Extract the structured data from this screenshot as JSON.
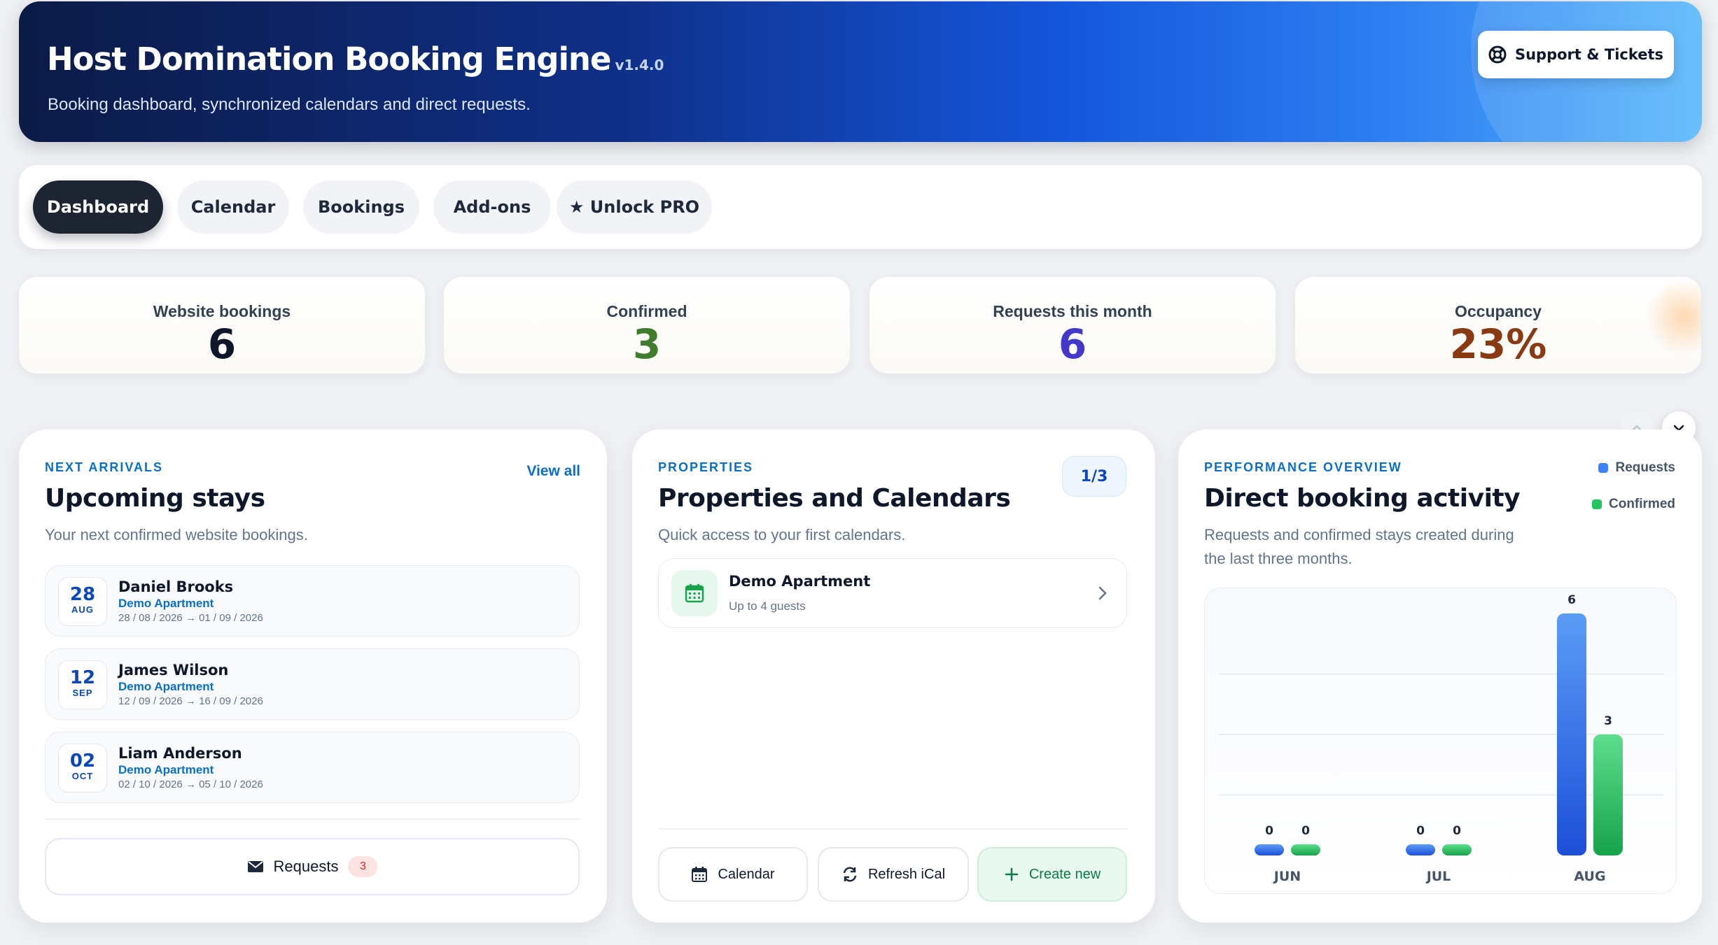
{
  "header": {
    "title": "Host Domination Booking Engine",
    "version": "v1.4.0",
    "subtitle": "Booking dashboard, synchronized calendars and direct requests.",
    "support_label": "Support & Tickets"
  },
  "nav": {
    "tabs": [
      {
        "label": "Dashboard",
        "active": true
      },
      {
        "label": "Calendar",
        "active": false
      },
      {
        "label": "Bookings",
        "active": false
      },
      {
        "label": "Add-ons",
        "active": false
      },
      {
        "label": "★ Unlock PRO",
        "active": false
      }
    ]
  },
  "stats": [
    {
      "label": "Website bookings",
      "value": "6",
      "color": "#0f172a"
    },
    {
      "label": "Confirmed",
      "value": "3",
      "color": "#3f7d2c"
    },
    {
      "label": "Requests this month",
      "value": "6",
      "color": "#4338ca"
    },
    {
      "label": "Occupancy",
      "value": "23%",
      "color": "#8a3a12"
    }
  ],
  "upcoming": {
    "eyebrow": "NEXT ARRIVALS",
    "title": "Upcoming stays",
    "subtitle": "Your next confirmed website bookings.",
    "view_all": "View all",
    "stays": [
      {
        "day": "28",
        "month": "AUG",
        "name": "Daniel Brooks",
        "property": "Demo Apartment",
        "dates": "28 / 08 / 2026 → 01 / 09 / 2026"
      },
      {
        "day": "12",
        "month": "SEP",
        "name": "James Wilson",
        "property": "Demo Apartment",
        "dates": "12 / 09 / 2026 → 16 / 09 / 2026"
      },
      {
        "day": "02",
        "month": "OCT",
        "name": "Liam Anderson",
        "property": "Demo Apartment",
        "dates": "02 / 10 / 2026 → 05 / 10 / 2026"
      }
    ],
    "requests_label": "Requests",
    "requests_count": "3"
  },
  "properties": {
    "eyebrow": "PROPERTIES",
    "title": "Properties and Calendars",
    "subtitle": "Quick access to your first calendars.",
    "pager": "1/3",
    "items": [
      {
        "name": "Demo Apartment",
        "guests": "Up to 4 guests"
      }
    ],
    "actions": {
      "calendar": "Calendar",
      "refresh": "Refresh iCal",
      "create": "Create new"
    }
  },
  "performance": {
    "eyebrow": "PERFORMANCE OVERVIEW",
    "title": "Direct booking activity",
    "subtitle_line1": "Requests and confirmed stays created during",
    "subtitle_line2": "the last three months."
  },
  "chart_data": {
    "type": "bar",
    "categories": [
      "JUN",
      "JUL",
      "AUG"
    ],
    "series": [
      {
        "name": "Requests",
        "values": [
          0,
          0,
          6
        ],
        "color": "#2f6fe8"
      },
      {
        "name": "Confirmed",
        "values": [
          0,
          0,
          3
        ],
        "color": "#22c05e"
      }
    ],
    "ylim": [
      0,
      6
    ],
    "grid": true,
    "legend": "top-right",
    "data_labels": true
  },
  "icons": {
    "support": "lifebuoy-icon",
    "mail": "envelope-icon",
    "calendar": "calendar-icon",
    "refresh": "refresh-icon",
    "plus": "plus-icon",
    "chevron": "chevron-right-icon"
  }
}
